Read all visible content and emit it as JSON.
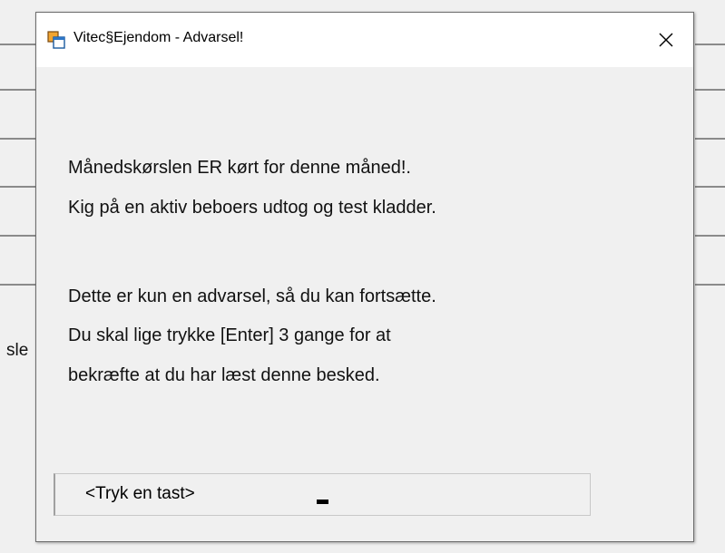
{
  "dialog": {
    "title": "Vitec§Ejendom - Advarsel!",
    "icons": {
      "app": "app-window-icon",
      "close": "close-icon"
    },
    "messages": [
      "Månedskørslen ER kørt for denne måned!.",
      "Kig på en aktiv beboers udtog og test kladder.",
      "Dette er kun en advarsel, så du kan fortsætte.",
      "Du skal lige trykke [Enter] 3 gange for at",
      "bekræfte at du har læst denne besked."
    ],
    "status_prompt": "<Tryk en tast>"
  },
  "background": {
    "partial_text": "sle"
  }
}
